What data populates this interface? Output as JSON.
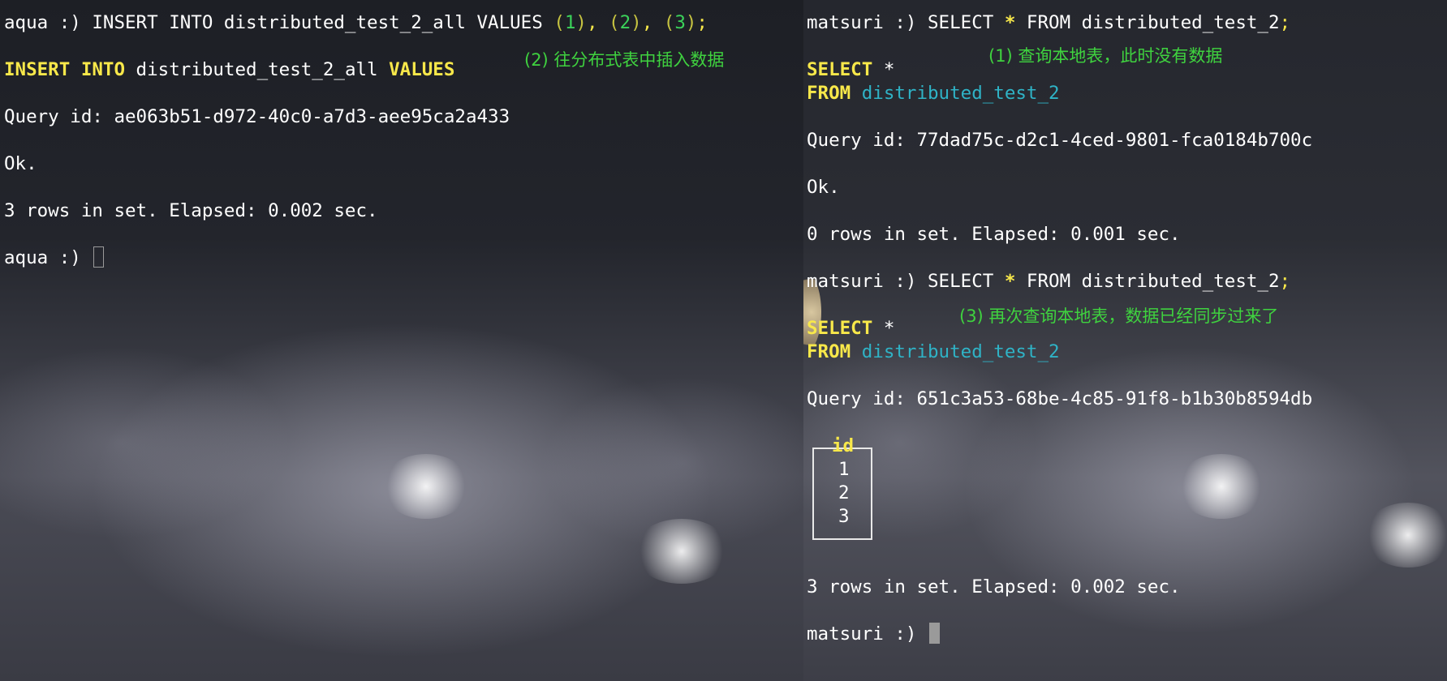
{
  "left": {
    "prompt": "aqua :)",
    "command": {
      "before_values": " INSERT INTO distributed_test_2_all VALUES ",
      "values": [
        {
          "open": "(",
          "num": "1",
          "close": ")"
        },
        {
          "open": "(",
          "num": "2",
          "close": ")"
        },
        {
          "open": "(",
          "num": "3",
          "close": ")"
        }
      ],
      "separator": ", ",
      "terminator": ";"
    },
    "echo": {
      "kw_insert": "INSERT INTO",
      "table": " distributed_test_2_all ",
      "kw_values": "VALUES"
    },
    "annotation": "(2) 往分布式表中插入数据",
    "query_id_label": "Query id: ",
    "query_id": "ae063b51-d972-40c0-a7d3-aee95ca2a433",
    "ok": "Ok.",
    "status": "3 rows in set. Elapsed: 0.002 sec.",
    "final_prompt": "aqua :)"
  },
  "right": {
    "prompt": "matsuri :)",
    "q1": {
      "cmd_a": " SELECT ",
      "star": "*",
      "cmd_b": " FROM distributed_test_2",
      "terminator": ";",
      "annotation": "(1) 查询本地表，此时没有数据",
      "kw_select": "SELECT",
      "select_rest": " *",
      "kw_from": "FROM",
      "table": "distributed_test_2",
      "query_id_label": "Query id: ",
      "query_id": "77dad75c-d2c1-4ced-9801-fca0184b700c",
      "ok": "Ok.",
      "status": "0 rows in set. Elapsed: 0.001 sec."
    },
    "q2": {
      "cmd_a": " SELECT ",
      "star": "*",
      "cmd_b": " FROM distributed_test_2",
      "terminator": ";",
      "annotation": "(3) 再次查询本地表，数据已经同步过来了",
      "kw_select": "SELECT",
      "select_rest": " *",
      "kw_from": "FROM",
      "table": "distributed_test_2",
      "query_id_label": "Query id: ",
      "query_id": "651c3a53-68be-4c85-91f8-b1b30b8594db",
      "result": {
        "header": "id",
        "rows": [
          "1",
          "2",
          "3"
        ]
      },
      "status": "3 rows in set. Elapsed: 0.002 sec."
    },
    "final_prompt": "matsuri :)"
  },
  "colors": {
    "keyword": "#f8e84a",
    "table_name": "#2fb3c6",
    "annotation": "#3fd23f",
    "number": "#3bd25a",
    "text": "#ffffff"
  }
}
